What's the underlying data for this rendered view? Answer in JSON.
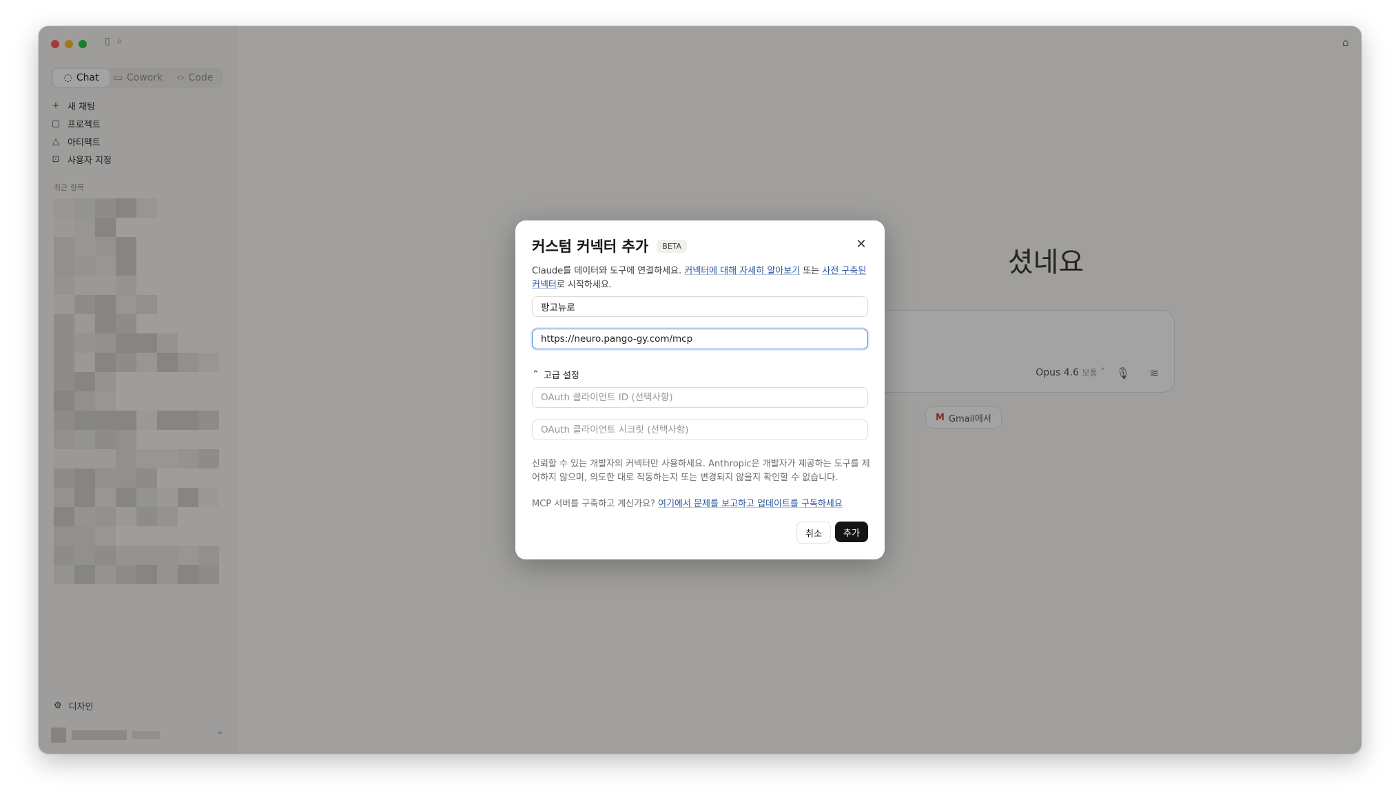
{
  "app": {
    "sidebar": {
      "modes": [
        {
          "label": "Chat",
          "icon": "chat-icon"
        },
        {
          "label": "Cowork",
          "icon": "cowork-icon"
        },
        {
          "label": "Code",
          "icon": "code-icon"
        }
      ],
      "nav": [
        {
          "label": "새 채팅",
          "icon": "plus-icon"
        },
        {
          "label": "프로젝트",
          "icon": "folder-icon"
        },
        {
          "label": "아티팩트",
          "icon": "artifact-icon"
        },
        {
          "label": "사용자 지정",
          "icon": "customize-icon"
        }
      ],
      "recents_label": "최근 항목",
      "settings_label": "디자인"
    },
    "main": {
      "greeting_partial": "셨네요",
      "model_label": "Opus 4.6",
      "model_suffix": "보통",
      "chip_label": "Gmail에서"
    }
  },
  "modal": {
    "title": "커스텀 커넥터 추가",
    "badge": "BETA",
    "description_prefix": "Claude를 데이터와 도구에 연결하세요. ",
    "description_link1": "커넥터에 대해 자세히 알아보기",
    "description_mid": " 또는 ",
    "description_link2": "사전 구축된 커넥터",
    "description_suffix": "로 시작하세요.",
    "name_value": "팡고뉴로",
    "url_value": "https://neuro.pango-gy.com/mcp",
    "advanced_label": "고급 설정",
    "client_id_placeholder": "OAuth 클라이언트 ID (선택사항)",
    "client_secret_placeholder": "OAuth 클라이언트 시크릿 (선택사항)",
    "warning": "신뢰할 수 있는 개발자의 커넥터만 사용하세요. Anthropic은 개발자가 제공하는 도구를 제어하지 않으며, 의도한 대로 작동하는지 또는 변경되지 않을지 확인할 수 없습니다.",
    "mcp_prefix": "MCP 서버를 구축하고 계신가요? ",
    "mcp_link": "여기에서 문제를 보고하고 업데이트를 구독하세요",
    "cancel_label": "취소",
    "add_label": "추가"
  }
}
